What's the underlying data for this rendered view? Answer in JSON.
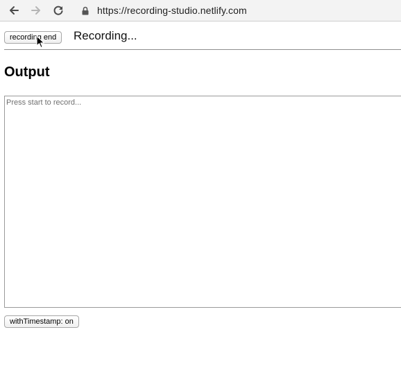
{
  "browser": {
    "url": "https://recording-studio.netlify.com",
    "icons": {
      "back": "arrow-left-icon",
      "forward": "arrow-right-icon",
      "reload": "reload-icon",
      "lock": "lock-icon"
    }
  },
  "toolbar": {
    "record_button_label": "recording end",
    "status": "Recording..."
  },
  "output": {
    "heading": "Output",
    "value": "",
    "placeholder": "Press start to record..."
  },
  "options": {
    "timestamp_button_label": "withTimestamp: on"
  },
  "colors": {
    "toolbar_background": "#f3f3f3",
    "divider": "#8e8e8e",
    "textarea_border": "#9a9a9a"
  }
}
